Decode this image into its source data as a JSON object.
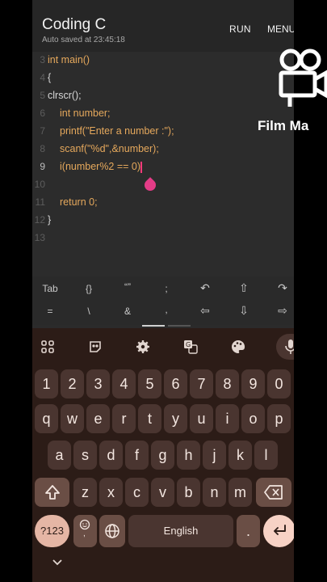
{
  "app": {
    "title": "Coding C",
    "subtitle": "Auto saved at 23:45:18",
    "run_label": "RUN",
    "menu_label": "MENU"
  },
  "code_lines": [
    {
      "n": "3",
      "text": "int main()"
    },
    {
      "n": "4",
      "text": "{"
    },
    {
      "n": "5",
      "text": "clrscr();"
    },
    {
      "n": "6",
      "text": "int number;"
    },
    {
      "n": "7",
      "text": "printf(\"Enter a number :\");"
    },
    {
      "n": "8",
      "text": "scanf(\"%d\",&number);"
    },
    {
      "n": "9",
      "text": "i(number%2 == 0)"
    },
    {
      "n": "10",
      "text": ""
    },
    {
      "n": "11",
      "text": "return 0;"
    },
    {
      "n": "12",
      "text": "}"
    },
    {
      "n": "13",
      "text": ""
    }
  ],
  "symbols": {
    "row1": [
      "Tab",
      "{}",
      "“”",
      ";",
      "↶",
      "⇧",
      "↷"
    ],
    "row2": [
      "=",
      "\\",
      "&",
      ",",
      "⇦",
      "⇩",
      "⇨"
    ]
  },
  "keyboard": {
    "numbers": [
      "1",
      "2",
      "3",
      "4",
      "5",
      "6",
      "7",
      "8",
      "9",
      "0"
    ],
    "row1": [
      "q",
      "w",
      "e",
      "r",
      "t",
      "y",
      "u",
      "i",
      "o",
      "p"
    ],
    "row2": [
      "a",
      "s",
      "d",
      "f",
      "g",
      "h",
      "j",
      "k",
      "l"
    ],
    "row3": [
      "z",
      "x",
      "c",
      "v",
      "b",
      "n",
      "m"
    ],
    "sym_key": "?123",
    "space_label": "English",
    "period": "."
  },
  "overlay": {
    "film_text": "Film Ma"
  },
  "icons": {
    "apps": "apps-grid-icon",
    "sticker": "sticker-icon",
    "settings": "gear-icon",
    "translate": "translate-icon",
    "palette": "palette-icon",
    "mic": "mic-icon"
  }
}
